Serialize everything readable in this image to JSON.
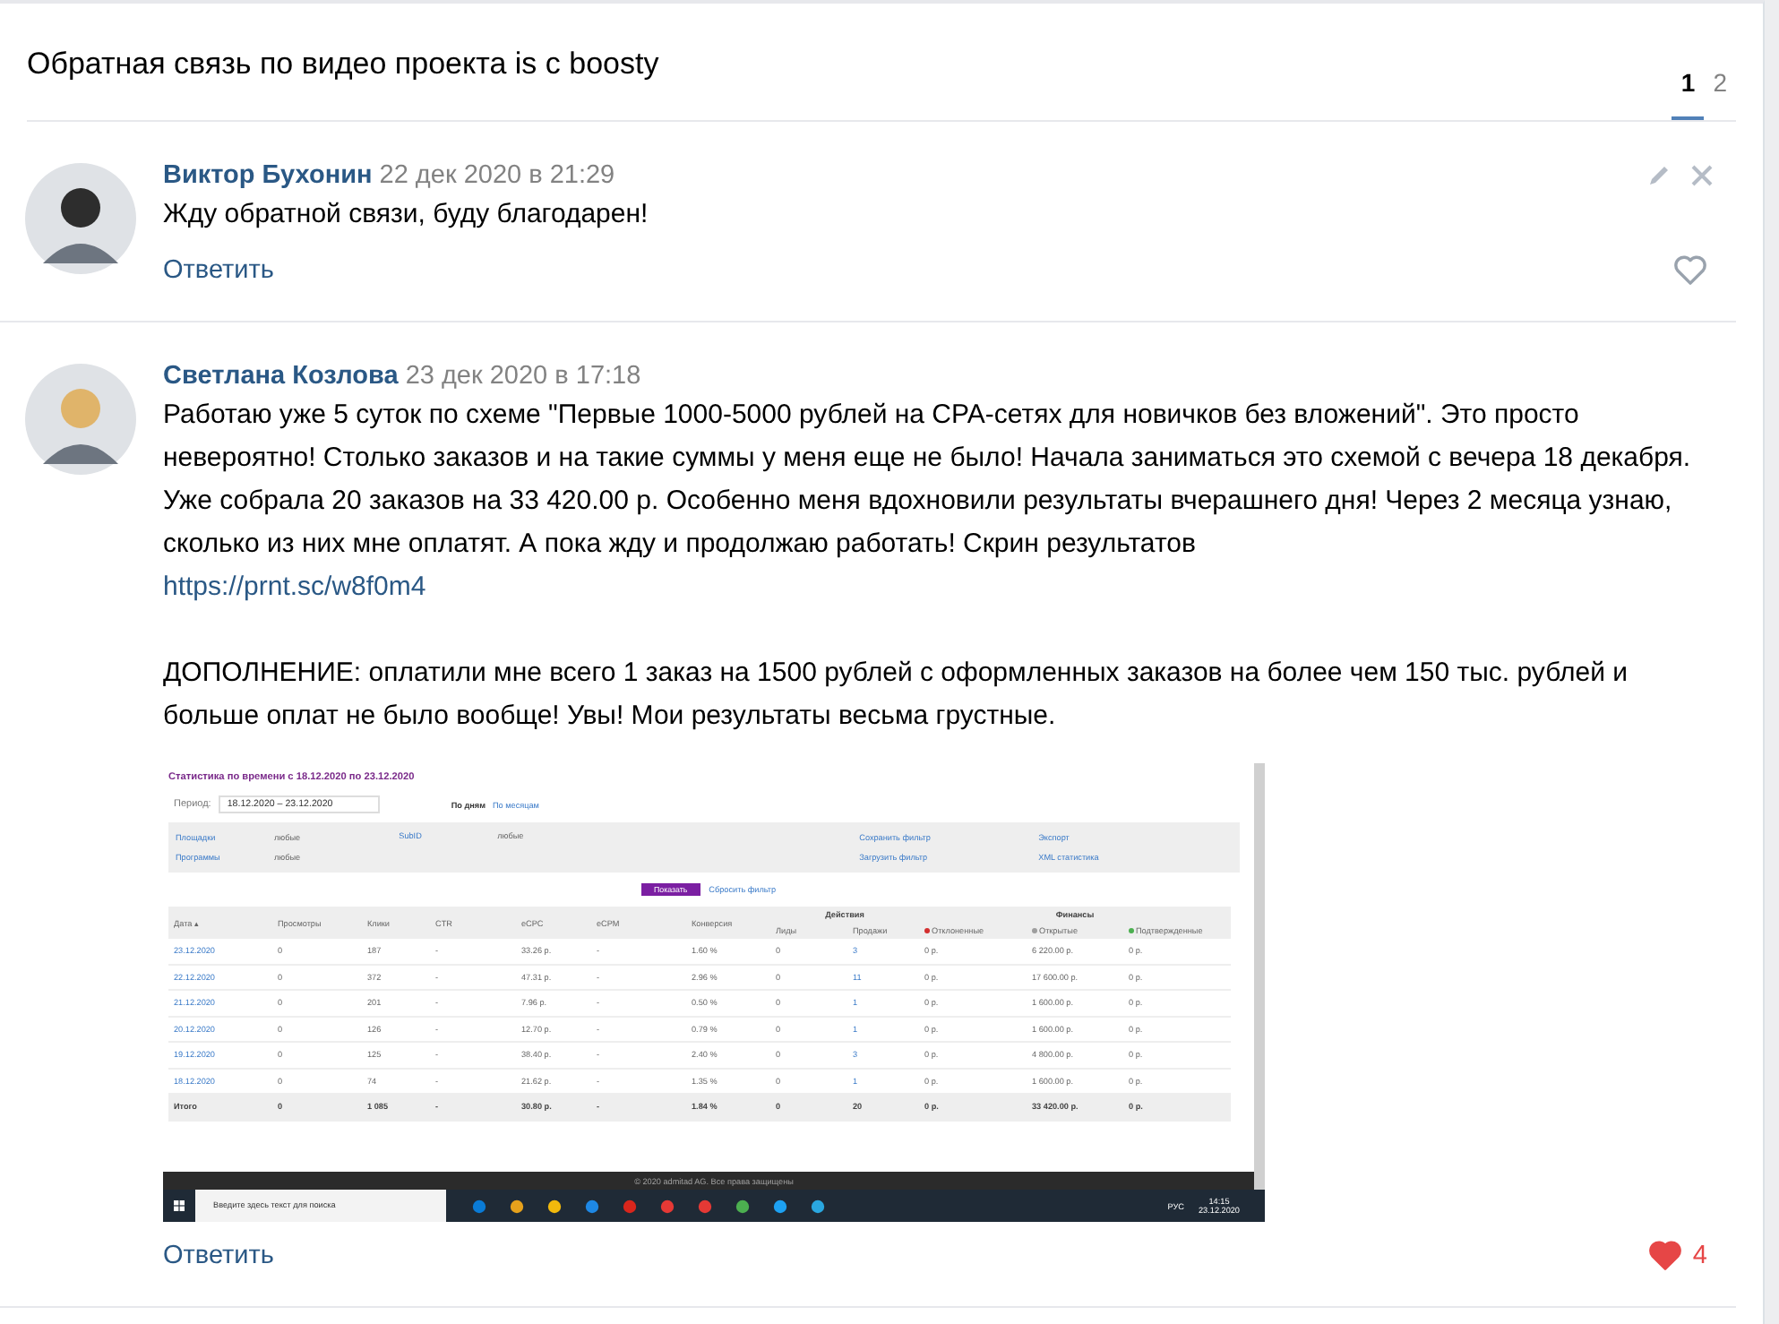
{
  "topic": {
    "title": "Обратная связь по видео проекта is с boosty",
    "pages": [
      {
        "label": "1",
        "selected": true
      },
      {
        "label": "2",
        "selected": false
      }
    ]
  },
  "comments": [
    {
      "author": "Виктор Бухонин",
      "date": "22 дек 2020 в 21:29",
      "avatar": {
        "color": "#2d2d2d"
      },
      "own": true,
      "paragraphs": [
        {
          "text": "Жду обратной связи, буду благодарен!"
        }
      ],
      "reply": "Ответить",
      "liked": false
    },
    {
      "author": "Светлана Козлова",
      "date": "23 дек 2020 в 17:18",
      "avatar": {
        "color": "#e0b46a"
      },
      "own": false,
      "paragraphs": [
        {
          "text": "Работаю уже 5 суток по схеме \"Первые 1000-5000 рублей на CPA-сетях для новичков без вложений\". Это просто невероятно! Столько заказов и на такие суммы у меня еще не было! Начала заниматься это схемой с вечера 18 декабря. Уже собрала 20 заказов на 33 420.00 р. Особенно меня вдохновили результаты вчерашнего дня! Через 2 месяца узнаю, сколько из них мне оплатят. А пока жду и продолжаю работать! Скрин результатов",
          "link": "https://prnt.sc/w8f0m4"
        },
        {
          "text": "ДОПОЛНЕНИЕ: оплатили мне всего 1 заказ на 1500 рублей с оформленных заказов на более чем 150 тыс. рублей и больше оплат не было вообще! Увы! Мои результаты весьма грустные."
        }
      ],
      "screenshot": {
        "title": "Статистика по времени с 18.12.2020 по 23.12.2020",
        "period_label": "Период:",
        "period_value": "18.12.2020 – 23.12.2020",
        "views": [
          {
            "label": "По дням",
            "selected": true
          },
          {
            "label": "По месяцам",
            "selected": false
          }
        ],
        "filters": [
          {
            "name": "Площадки",
            "value": "любые"
          },
          {
            "name": "Программы",
            "value": "любые"
          }
        ],
        "subid": {
          "name": "SubID",
          "value": "любые"
        },
        "filter_links": [
          "Сохранить фильтр",
          "Загрузить фильтр"
        ],
        "export_links": [
          "Экспорт",
          "XML статистика"
        ],
        "show_button": "Показать",
        "reset_link": "Сбросить фильтр",
        "column_groups": [
          {
            "kind": "actions",
            "label": "Действия"
          },
          {
            "kind": "finance",
            "label": "Финансы"
          }
        ],
        "columns": [
          {
            "label": "Дата ▴",
            "kind": "plain"
          },
          {
            "label": "Просмотры",
            "kind": "plain"
          },
          {
            "label": "Клики",
            "kind": "plain"
          },
          {
            "label": "CTR",
            "kind": "plain"
          },
          {
            "label": "eCPC",
            "kind": "plain"
          },
          {
            "label": "eCPM",
            "kind": "plain"
          },
          {
            "label": "Конверсия",
            "kind": "plain"
          },
          {
            "label": "Лиды",
            "kind": "actions"
          },
          {
            "label": "Продажи",
            "kind": "actions"
          },
          {
            "label": "Отклоненные",
            "kind": "finance",
            "color": "#d32f2f"
          },
          {
            "label": "Открытые",
            "kind": "finance",
            "color": "#9e9e9e"
          },
          {
            "label": "Подтвержденные",
            "kind": "finance",
            "color": "#4caf50"
          }
        ],
        "rows": [
          {
            "total": false,
            "cells": [
              "23.12.2020",
              "0",
              "187",
              "-",
              "33.26 р.",
              "-",
              "1.60 %",
              "0",
              "3",
              "0 р.",
              "6 220.00 р.",
              "0 р."
            ]
          },
          {
            "total": false,
            "cells": [
              "22.12.2020",
              "0",
              "372",
              "-",
              "47.31 р.",
              "-",
              "2.96 %",
              "0",
              "11",
              "0 р.",
              "17 600.00 р.",
              "0 р."
            ]
          },
          {
            "total": false,
            "cells": [
              "21.12.2020",
              "0",
              "201",
              "-",
              "7.96 р.",
              "-",
              "0.50 %",
              "0",
              "1",
              "0 р.",
              "1 600.00 р.",
              "0 р."
            ]
          },
          {
            "total": false,
            "cells": [
              "20.12.2020",
              "0",
              "126",
              "-",
              "12.70 р.",
              "-",
              "0.79 %",
              "0",
              "1",
              "0 р.",
              "1 600.00 р.",
              "0 р."
            ]
          },
          {
            "total": false,
            "cells": [
              "19.12.2020",
              "0",
              "125",
              "-",
              "38.40 р.",
              "-",
              "2.40 %",
              "0",
              "3",
              "0 р.",
              "4 800.00 р.",
              "0 р."
            ]
          },
          {
            "total": false,
            "cells": [
              "18.12.2020",
              "0",
              "74",
              "-",
              "21.62 р.",
              "-",
              "1.35 %",
              "0",
              "1",
              "0 р.",
              "1 600.00 р.",
              "0 р."
            ]
          },
          {
            "total": true,
            "cells": [
              "Итого",
              "0",
              "1 085",
              "-",
              "30.80 р.",
              "-",
              "1.84 %",
              "0",
              "20",
              "0 р.",
              "33 420.00 р.",
              "0 р."
            ]
          }
        ],
        "footer": "© 2020 admitad AG. Все права защищены",
        "taskbar": {
          "search_placeholder": "Введите здесь текст для поиска",
          "language": "РУС",
          "time": "14:15",
          "date": "23.12.2020"
        }
      },
      "reply": "Ответить",
      "liked": true,
      "like_count": "4"
    }
  ]
}
